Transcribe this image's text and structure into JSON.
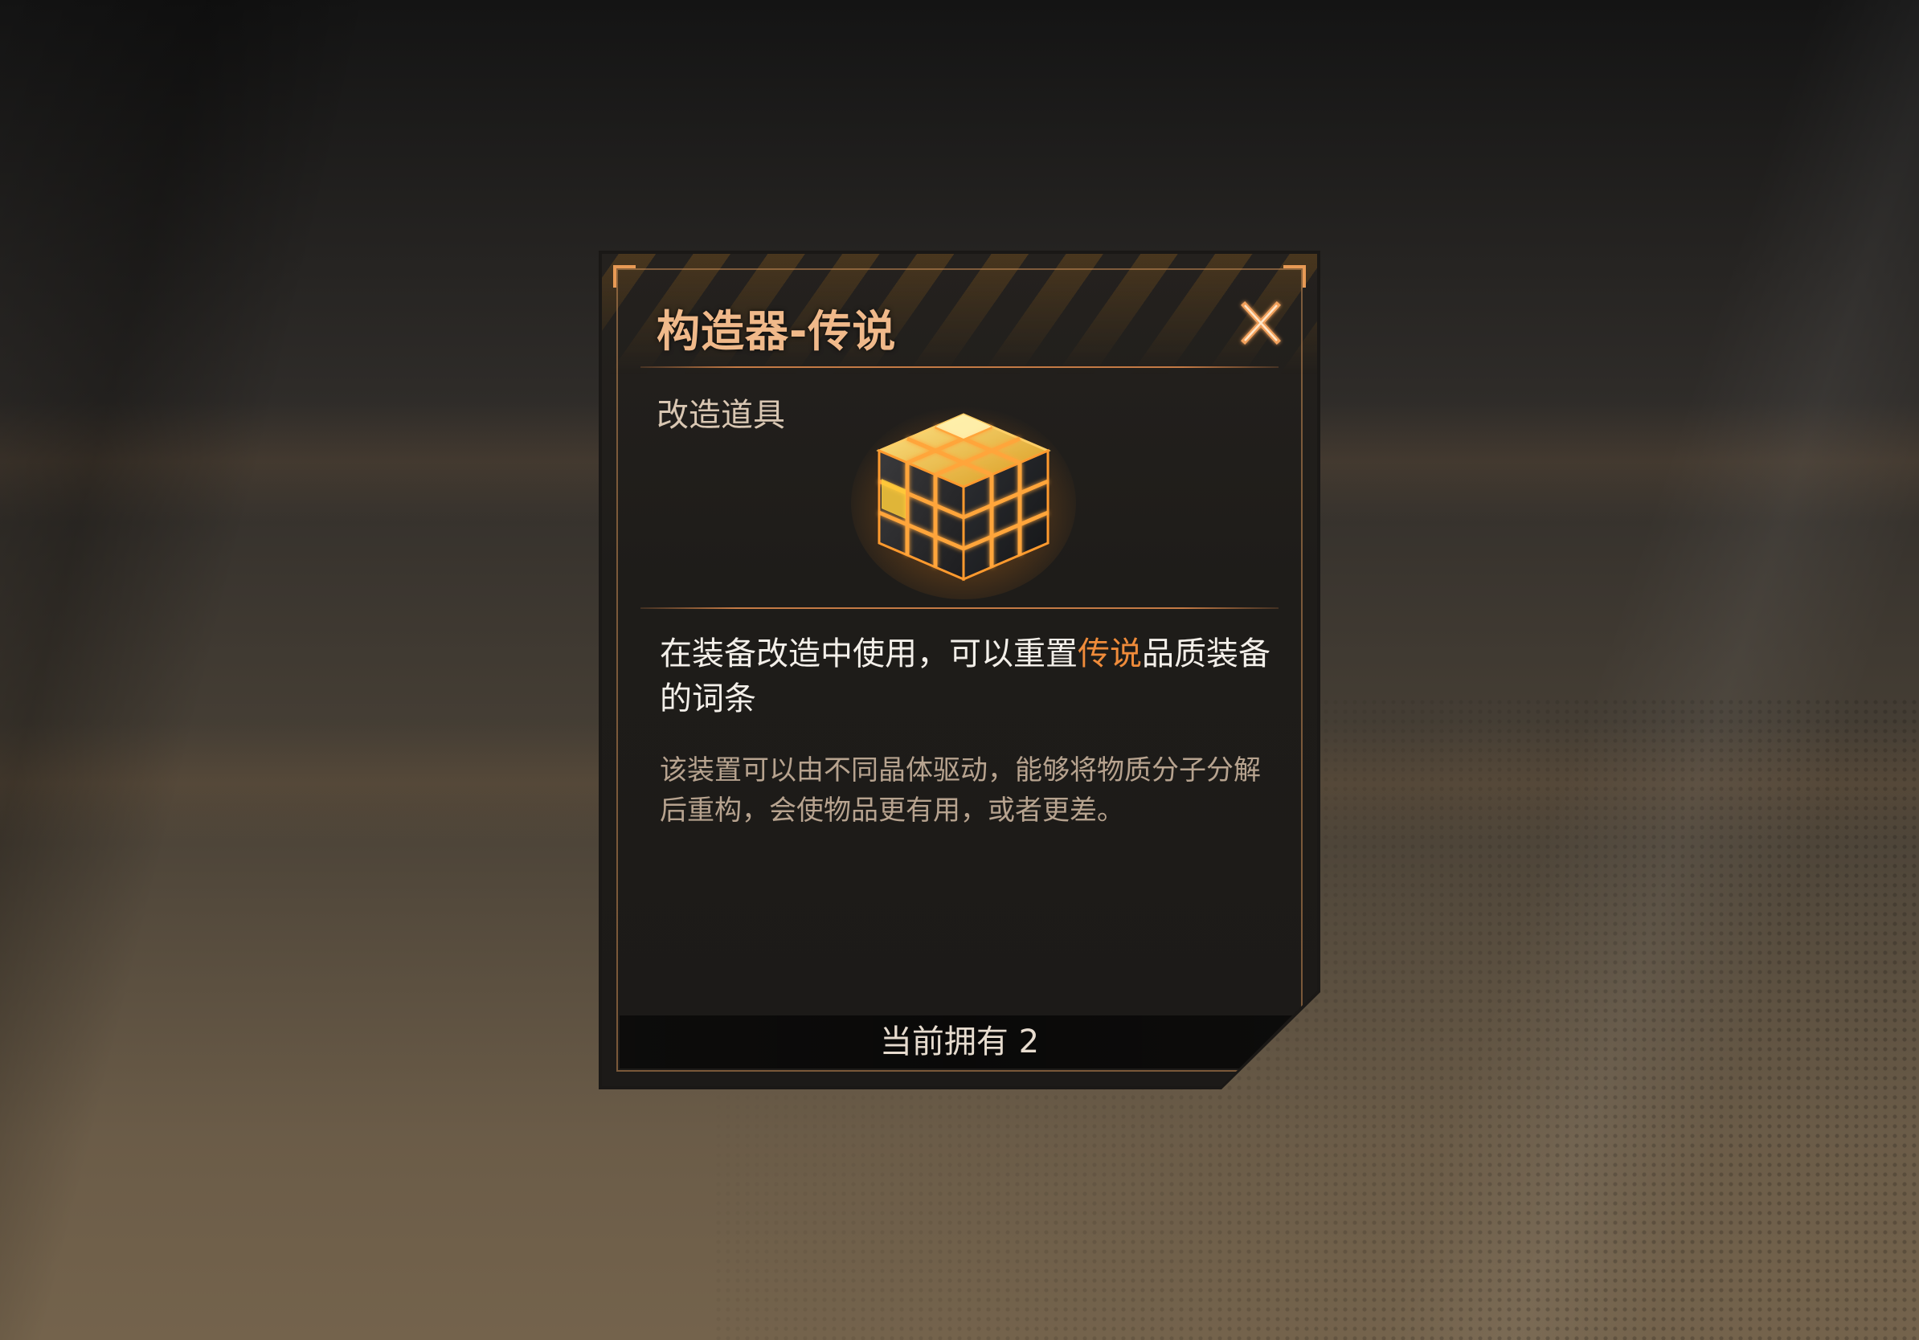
{
  "dialog": {
    "title": "构造器-传说",
    "category": "改造道具",
    "close_icon": "close-x-icon",
    "item_icon": "glowing-cube-icon",
    "description_main_prefix": "在装备改造中使用，可以重置",
    "description_main_highlight": "传说",
    "description_main_suffix": "品质装备的词条",
    "description_flavor": "该装置可以由不同晶体驱动，能够将物质分子分解后重构，会使物品更有用，或者更差。",
    "owned_text": "当前拥有 2"
  },
  "colors": {
    "accent_orange": "#ef8b3a",
    "title_color": "#f0b98a",
    "frame_color": "#c47a45"
  }
}
